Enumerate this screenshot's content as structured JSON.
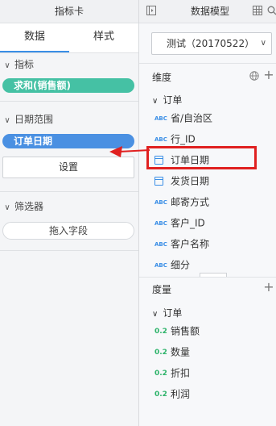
{
  "left_panel": {
    "title": "指标卡",
    "tabs": [
      "数据",
      "样式"
    ],
    "sections": {
      "metric": {
        "label": "指标",
        "pill": "求和(销售额)"
      },
      "date_range": {
        "label": "日期范围",
        "pill": "订单日期",
        "settings_button": "设置"
      },
      "filter": {
        "label": "筛选器",
        "drop_hint": "拖入字段"
      }
    }
  },
  "right_panel": {
    "title": "数据模型",
    "dataset": "测试（20170522）",
    "dimensions": {
      "label": "维度",
      "group": "订单",
      "fields": [
        {
          "type": "ABC",
          "name": "省/自治区"
        },
        {
          "type": "ABC",
          "name": "行_ID"
        },
        {
          "type": "date",
          "name": "订单日期"
        },
        {
          "type": "date",
          "name": "发货日期"
        },
        {
          "type": "ABC",
          "name": "邮寄方式"
        },
        {
          "type": "ABC",
          "name": "客户_ID"
        },
        {
          "type": "ABC",
          "name": "客户名称"
        },
        {
          "type": "ABC",
          "name": "细分"
        }
      ]
    },
    "measures": {
      "label": "度量",
      "group": "订单",
      "fields": [
        {
          "type": "0.2",
          "name": "销售额"
        },
        {
          "type": "0.2",
          "name": "数量"
        },
        {
          "type": "0.2",
          "name": "折扣"
        },
        {
          "type": "0.2",
          "name": "利润"
        }
      ]
    }
  },
  "colors": {
    "metric_pill": "#45c1a4",
    "date_pill": "#4a90e2",
    "tab_active": "#3a8ee6",
    "highlight_box": "#e02020",
    "arrow": "#e02020"
  }
}
